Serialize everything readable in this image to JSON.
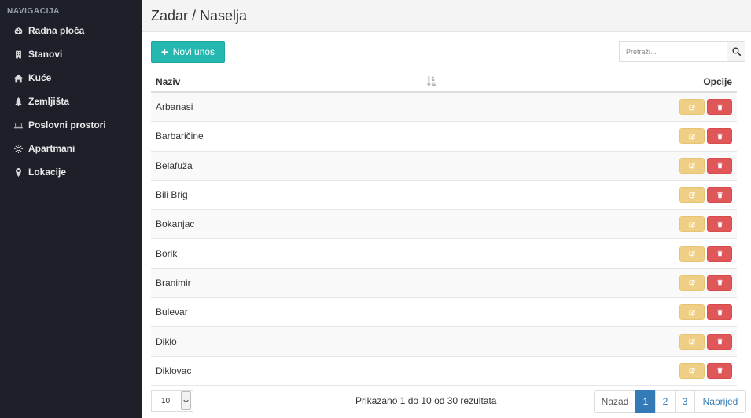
{
  "sidebar": {
    "heading": "NAVIGACIJA",
    "items": [
      {
        "label": "Radna ploča",
        "icon": "dashboard-icon"
      },
      {
        "label": "Stanovi",
        "icon": "building-icon"
      },
      {
        "label": "Kuće",
        "icon": "home-icon"
      },
      {
        "label": "Zemljišta",
        "icon": "tree-icon"
      },
      {
        "label": "Poslovni prostori",
        "icon": "laptop-icon"
      },
      {
        "label": "Apartmani",
        "icon": "sun-icon"
      },
      {
        "label": "Lokacije",
        "icon": "map-marker-icon"
      }
    ]
  },
  "header": {
    "title": "Zadar / Naselja"
  },
  "toolbar": {
    "new_label": "Novi unos",
    "search_placeholder": "Pretraži..."
  },
  "table": {
    "col_name": "Naziv",
    "col_options": "Opcije",
    "rows": [
      "Arbanasi",
      "Barbaričine",
      "Belafuža",
      "Bili Brig",
      "Bokanjac",
      "Borik",
      "Branimir",
      "Bulevar",
      "Diklo",
      "Diklovac"
    ]
  },
  "footer": {
    "per_page": "10",
    "summary": "Prikazano 1 do 10 od 30 rezultata",
    "prev": "Nazad",
    "pages": [
      "1",
      "2",
      "3"
    ],
    "active_page": "1",
    "next": "Naprijed"
  },
  "colors": {
    "sidebar_bg": "#1d2029",
    "new_button": "#25b8b0",
    "edit_button": "#efcf86",
    "delete_button": "#e05759",
    "active_page": "#337ab7"
  }
}
